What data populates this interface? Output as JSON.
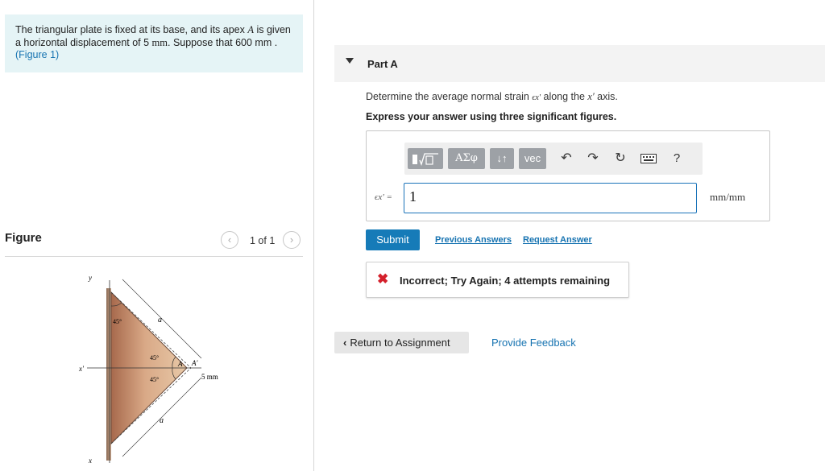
{
  "problem": {
    "text_1": "The triangular plate is fixed at its base, and its apex ",
    "apex_symbol": "A",
    "text_2": " is given a horizontal displacement of 5 ",
    "unit_mm": "mm",
    "text_3": ". Suppose that ",
    "value_600": "600 mm",
    "text_4": " . ",
    "figure_link": "(Figure 1)"
  },
  "figure_panel": {
    "title": "Figure",
    "pager": "1 of 1",
    "prev_icon": "chevron-left-icon",
    "next_icon": "chevron-right-icon",
    "labels": {
      "y": "y",
      "x_prime": "x′",
      "x": "x",
      "a_top": "a",
      "a_bottom": "a",
      "angle_45_top": "45°",
      "angle_45_mid_upper": "45°",
      "angle_45_mid_lower": "45°",
      "apex": "A",
      "apex_prime": "A′",
      "disp": "5 mm"
    },
    "colors": {
      "plate_light": "#e8c9a8",
      "plate_dark": "#a7694c"
    }
  },
  "part": {
    "title": "Part A",
    "question_1": "Determine the average normal strain ",
    "strain_symbol": "ϵx′",
    "question_2": " along the ",
    "axis_symbol": "x′",
    "question_3": " axis.",
    "instruction": "Express your answer using three significant figures."
  },
  "toolbar": {
    "templates_icon": "templates-icon",
    "greek_label": "ΑΣφ",
    "arrows_icon": "up-down-arrows-icon",
    "vec_label": "vec",
    "undo_icon": "undo-icon",
    "redo_icon": "redo-icon",
    "reset_icon": "reset-icon",
    "keyboard_icon": "keyboard-icon",
    "help_label": "?"
  },
  "answer": {
    "label": "ϵx′ =",
    "value": "1",
    "unit": "mm/mm"
  },
  "actions": {
    "submit": "Submit",
    "previous_answers": "Previous Answers",
    "request_answer": "Request Answer"
  },
  "feedback": {
    "icon": "x-icon",
    "message": "Incorrect; Try Again; 4 attempts remaining"
  },
  "footer": {
    "return": "Return to Assignment",
    "provide_feedback": "Provide Feedback"
  },
  "colors": {
    "accent": "#167bb8",
    "link": "#1673b1",
    "error": "#d4202b",
    "problem_bg": "#e5f4f6"
  }
}
